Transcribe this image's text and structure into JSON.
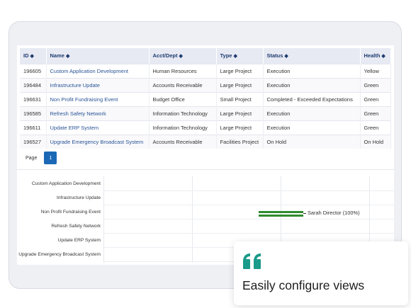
{
  "table": {
    "columns": [
      {
        "label": "ID",
        "sort_icon": "sort-icon"
      },
      {
        "label": "Name",
        "sort_icon": "sort-icon"
      },
      {
        "label": "Acct/Dept",
        "sort_icon": "sort-icon"
      },
      {
        "label": "Type",
        "sort_icon": "sort-icon"
      },
      {
        "label": "Status",
        "sort_icon": "sort-icon"
      },
      {
        "label": "Health",
        "sort_icon": "sort-icon"
      }
    ],
    "rows": [
      {
        "id": "196605",
        "name": "Custom Application Development",
        "dept": "Human Resources",
        "type": "Large Project",
        "status": "Execution",
        "health": "Yellow"
      },
      {
        "id": "196484",
        "name": "Infrastructure Update",
        "dept": "Accounts Receivable",
        "type": "Large Project",
        "status": "Execution",
        "health": "Green"
      },
      {
        "id": "196631",
        "name": "Non Profit Fundraising Event",
        "dept": "Budget Office",
        "type": "Small Project",
        "status": "Completed - Exceeded Expectations",
        "health": "Green"
      },
      {
        "id": "196585",
        "name": "Refresh Safety Network",
        "dept": "Information Technology",
        "type": "Large Project",
        "status": "Execution",
        "health": "Green"
      },
      {
        "id": "196611",
        "name": "Update ERP System",
        "dept": "Information Technology",
        "type": "Large Project",
        "status": "Execution",
        "health": "Green"
      },
      {
        "id": "196527",
        "name": "Upgrade Emergency Broadcast System",
        "dept": "Accounts Receivable",
        "type": "Facilities Project",
        "status": "On Hold",
        "health": "On Hold"
      }
    ]
  },
  "pager": {
    "label": "Page",
    "current": "1"
  },
  "gantt": {
    "rows": [
      "Custom Application Development",
      "Infrastructure Update",
      "Non Profit Fundraising Event",
      "Refresh Safety Network",
      "Update ERP System",
      "Upgrade Emergency Broadcast System"
    ],
    "bar_label": "Sarah Director (100%)",
    "bar_color": "#2e8b2e"
  },
  "callout": {
    "icon": "quote-icon",
    "text": "Easily configure views",
    "accent": "#1a9a8a"
  },
  "colors": {
    "header_bg": "#e7eaf3",
    "header_text": "#1f3b70",
    "link": "#2b5597",
    "page_button": "#1b69b6"
  }
}
